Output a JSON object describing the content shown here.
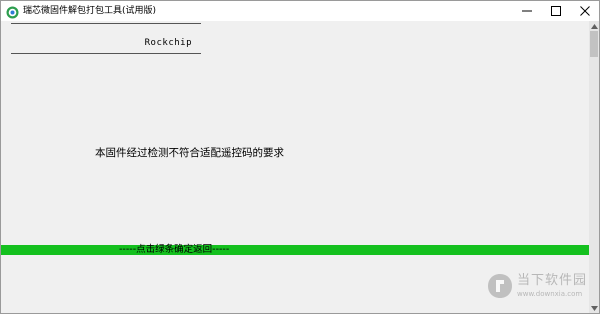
{
  "window": {
    "title": "瑞芯微固件解包打包工具(试用版)",
    "icon": "app-logo-icon"
  },
  "titlebar_buttons": {
    "minimize": "minimize-icon",
    "maximize": "maximize-icon",
    "close": "close-icon"
  },
  "content": {
    "brand_label": "Rockchip",
    "message": "本固件经过检测不符合适配遥控码的要求",
    "progress_label": "-----点击绿条确定返回-----",
    "progress_color": "#14c01e"
  },
  "watermark": {
    "name": "当下软件园",
    "url": "www.downxia.com"
  }
}
